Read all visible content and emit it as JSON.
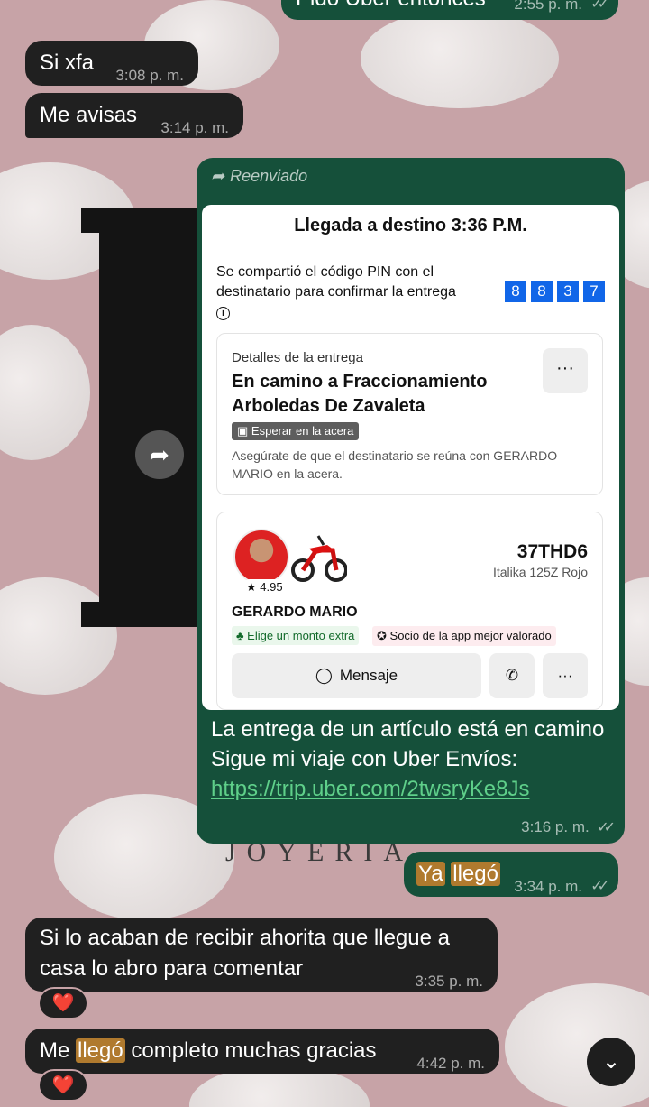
{
  "messages": {
    "m0": {
      "text": "Pido Uber entonces",
      "time": "2:55 p. m.",
      "ticks": "✓✓"
    },
    "m1": {
      "text": "Si xfa",
      "time": "3:08 p. m."
    },
    "m2": {
      "text": "Me avisas",
      "time": "3:14 p. m."
    },
    "forward": {
      "label": "Reenviado",
      "card": {
        "title": "Llegada a destino 3:36 P.M.",
        "pin_text": "Se compartió el código PIN con el destinatario para confirmar la entrega",
        "pin_digits": [
          "8",
          "8",
          "3",
          "7"
        ],
        "details_label": "Detalles de la entrega",
        "destination": "En camino a Fraccionamiento Arboledas De Zavaleta",
        "tag": "Esperar en la acera",
        "note": "Asegúrate de que el destinatario se reúna con GERARDO MARIO en la acera.",
        "rating": "4.95",
        "plate": "37THD6",
        "vehicle": "Italika 125Z Rojo",
        "driver": "GERARDO MARIO",
        "chip_extra": "Elige un monto extra",
        "chip_partner": "Socio de la app mejor valorado",
        "message_button": "Mensaje",
        "more_label": "···"
      },
      "text_before": "La entrega de un artículo está en camino Sigue mi viaje con Uber Envíos: ",
      "link": "https://trip.uber.com/2twsryKe8Js",
      "time": "3:16 p. m.",
      "ticks": "✓✓"
    },
    "m3": {
      "part1": "Ya",
      "part2": "llegó",
      "time": "3:34 p. m.",
      "ticks": "✓✓"
    },
    "m4": {
      "text": "Si lo acaban de recibir ahorita que llegue a casa lo abro para comentar",
      "time": "3:35 p. m.",
      "reaction": "❤️"
    },
    "m5": {
      "pre": "Me ",
      "hl": "llegó",
      "post": " completo muchas gracias",
      "time": "4:42 p. m.",
      "reaction": "❤️"
    }
  },
  "wallpaper": {
    "watermark": "JOYERIA"
  },
  "colors": {
    "incoming": "#202020",
    "outgoing": "#15503a",
    "pin": "#1166e8",
    "highlight": "#b07a2e"
  }
}
